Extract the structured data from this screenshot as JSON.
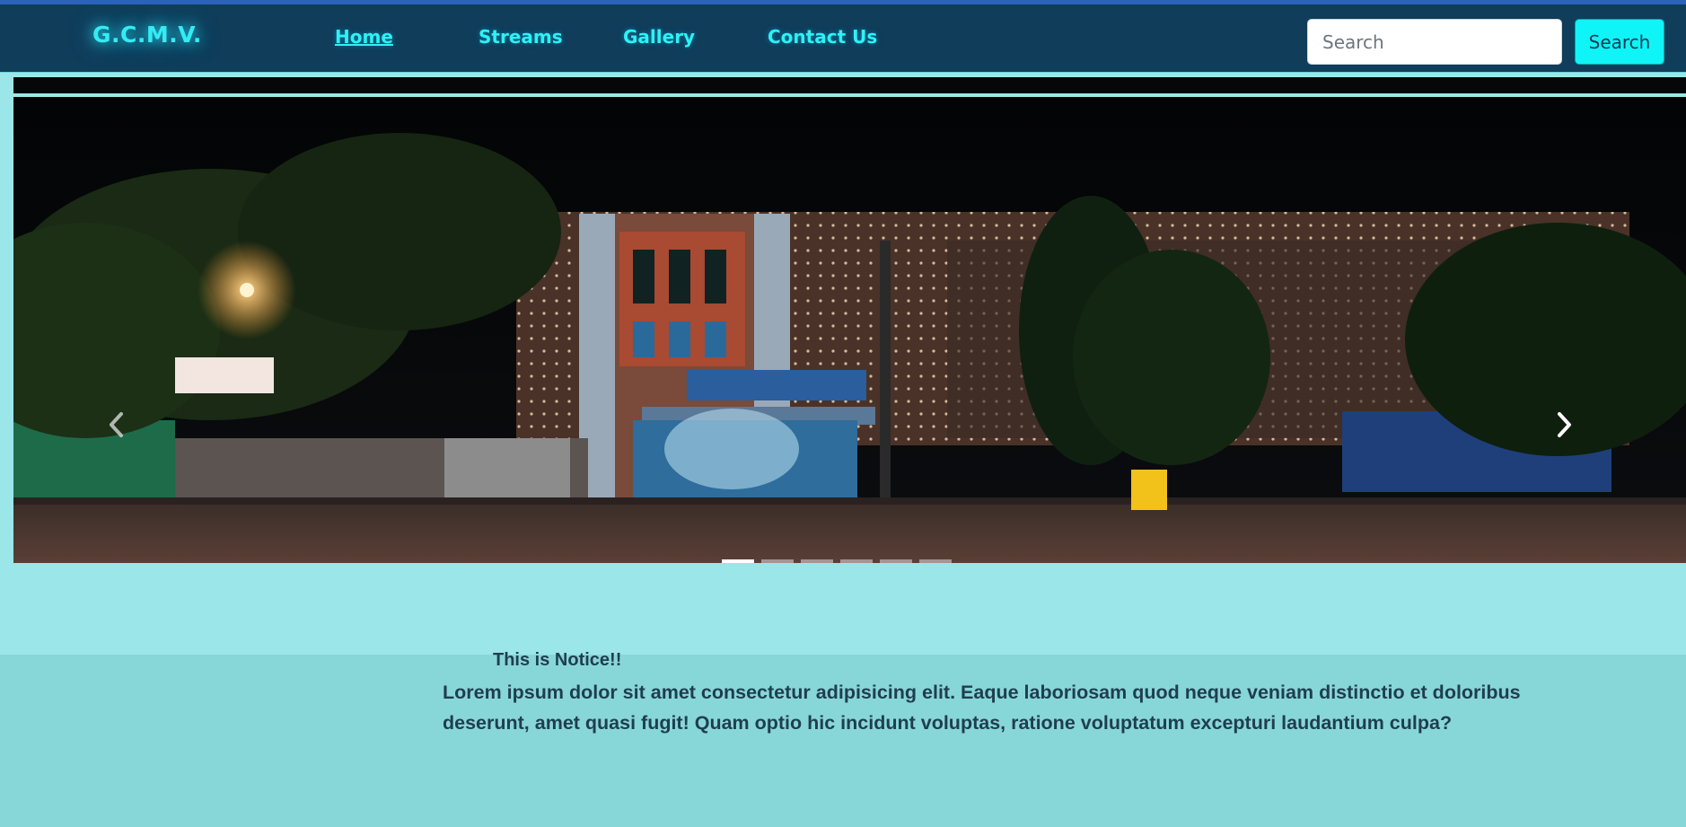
{
  "navbar": {
    "brand": "G.C.M.V.",
    "links": [
      {
        "label": "Home",
        "active": true
      },
      {
        "label": "Streams",
        "active": false
      },
      {
        "label": "Gallery",
        "active": false
      },
      {
        "label": "Contact Us",
        "active": false
      }
    ],
    "search": {
      "placeholder": "Search",
      "value": ""
    },
    "search_button": "Search"
  },
  "carousel": {
    "prev_icon": "chevron-left-icon",
    "next_icon": "chevron-right-icon",
    "slide_count": 6,
    "active_index": 0
  },
  "notice": {
    "title": "This is Notice!!",
    "body": "Lorem ipsum dolor sit amet consectetur adipisicing elit. Eaque laboriosam quod neque veniam distinctio et doloribus deserunt, amet quasi fugit! Quam optio hic incidunt voluptas, ratione voluptatum excepturi laudantium culpa?"
  },
  "colors": {
    "navbar_bg": "#0f3d5a",
    "brand": "#33ecf5",
    "link": "#2ef1f5",
    "page_bg": "#9be6e8",
    "notice_bg": "#88d7d8",
    "notice_text": "#1f3e4f"
  }
}
